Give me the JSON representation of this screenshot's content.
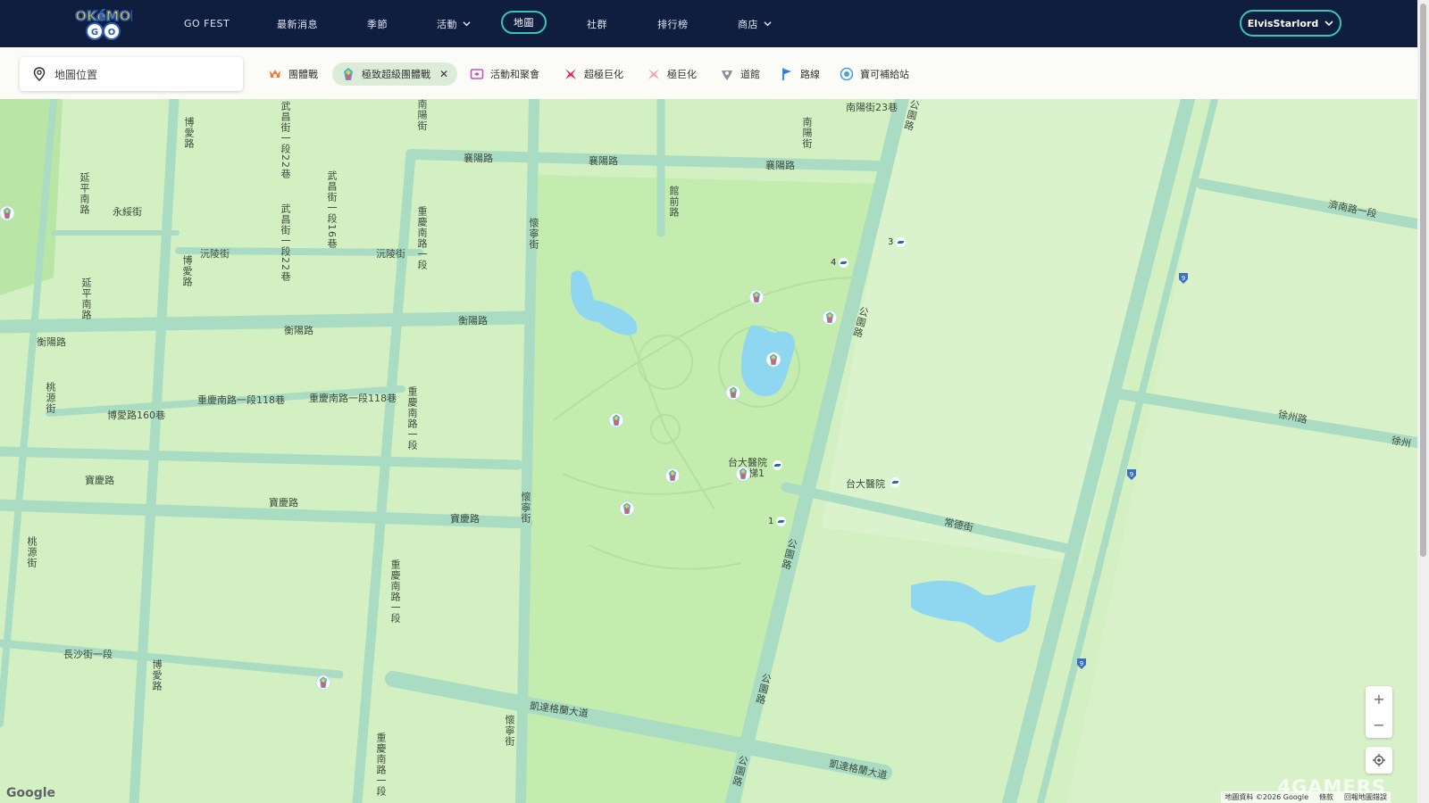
{
  "nav": {
    "links": [
      "GO FEST",
      "最新消息",
      "季節",
      "活動",
      "地圖",
      "社群",
      "排行榜",
      "商店"
    ],
    "active": "地圖",
    "user": "ElvisStarlord"
  },
  "filter": {
    "search_placeholder": "地圖位置",
    "chips": [
      {
        "label": "團體戰",
        "icon": "raid-icon",
        "selected": false
      },
      {
        "label": "極致超級團體戰",
        "icon": "max-battle-icon",
        "selected": true
      },
      {
        "label": "活動和聚會",
        "icon": "event-ticket-icon",
        "selected": false
      },
      {
        "label": "超極巨化",
        "icon": "gigantamax-icon",
        "selected": false
      },
      {
        "label": "極巨化",
        "icon": "dynamax-icon",
        "selected": false
      },
      {
        "label": "道館",
        "icon": "gym-icon",
        "selected": false
      },
      {
        "label": "路線",
        "icon": "route-flag-icon",
        "selected": false
      },
      {
        "label": "寶可補給站",
        "icon": "pokestop-icon",
        "selected": false
      }
    ]
  },
  "map": {
    "street_labels": {
      "xiangyang1": "襄陽路",
      "xiangyang2": "襄陽路",
      "xiangyang3": "襄陽路",
      "hengyang1": "衡陽路",
      "hengyang2": "衡陽路",
      "hengyang3": "衡陽路",
      "baoqing1": "寶慶路",
      "baoqing2": "寶慶路",
      "baoqing3": "寶慶路",
      "yongsui": "永綏街",
      "yuanling1": "沅陵街",
      "yuanling2": "沅陵街",
      "boai160": "博愛路160巷",
      "chongqing118a": "重慶南路一段118巷",
      "chongqing118b": "重慶南路一段118巷",
      "changsha": "長沙街一段",
      "ketagalan1": "凱達格蘭大道",
      "ketagalan2": "凱達格蘭大道",
      "jinan": "濟南路一段",
      "xuzhou": "徐州路",
      "xuzhou2": "徐州",
      "changde": "常德街",
      "nanyang23": "南陽街23巷",
      "hospital_stn": "台大醫院",
      "hospital_exit": "台大醫院",
      "exit_ladder": "梯1",
      "park1": "公園路",
      "park2": "公園路",
      "park3": "公園路",
      "park4": "公園路",
      "park5": "公園路",
      "boai1": "博愛路",
      "boai2": "博愛路",
      "boai3": "博愛路",
      "wuchang1": "武昌街一段22巷",
      "wuchang2": "武昌街一段16巷",
      "wuchang3": "武昌街一段22巷",
      "chongqing1": "重慶南路一段",
      "chongqing2": "重慶南路一段",
      "chongqing3": "重慶南路一段",
      "chongqing4": "重慶南路一段",
      "nanyang1": "南陽街",
      "nanyang2": "南陽街",
      "huaining1": "懷寧街",
      "huaining2": "懷寧街",
      "huaining3": "懷寧街",
      "taoyuan1": "桃源街",
      "taoyuan2": "桃源街",
      "yanping": "延平南路",
      "yanping2": "延平南路",
      "guanqian": "館前路"
    },
    "mrt_exits": [
      "3",
      "4",
      "1"
    ],
    "pin_count": 10,
    "route_shields": 4
  },
  "zoom": {
    "in": "+",
    "out": "−"
  },
  "footer": {
    "google": "Google",
    "attribution": [
      "地圖資料 ©2026 Google",
      "條款",
      "回報地圖錯誤"
    ],
    "watermark": "4GAMERS"
  }
}
